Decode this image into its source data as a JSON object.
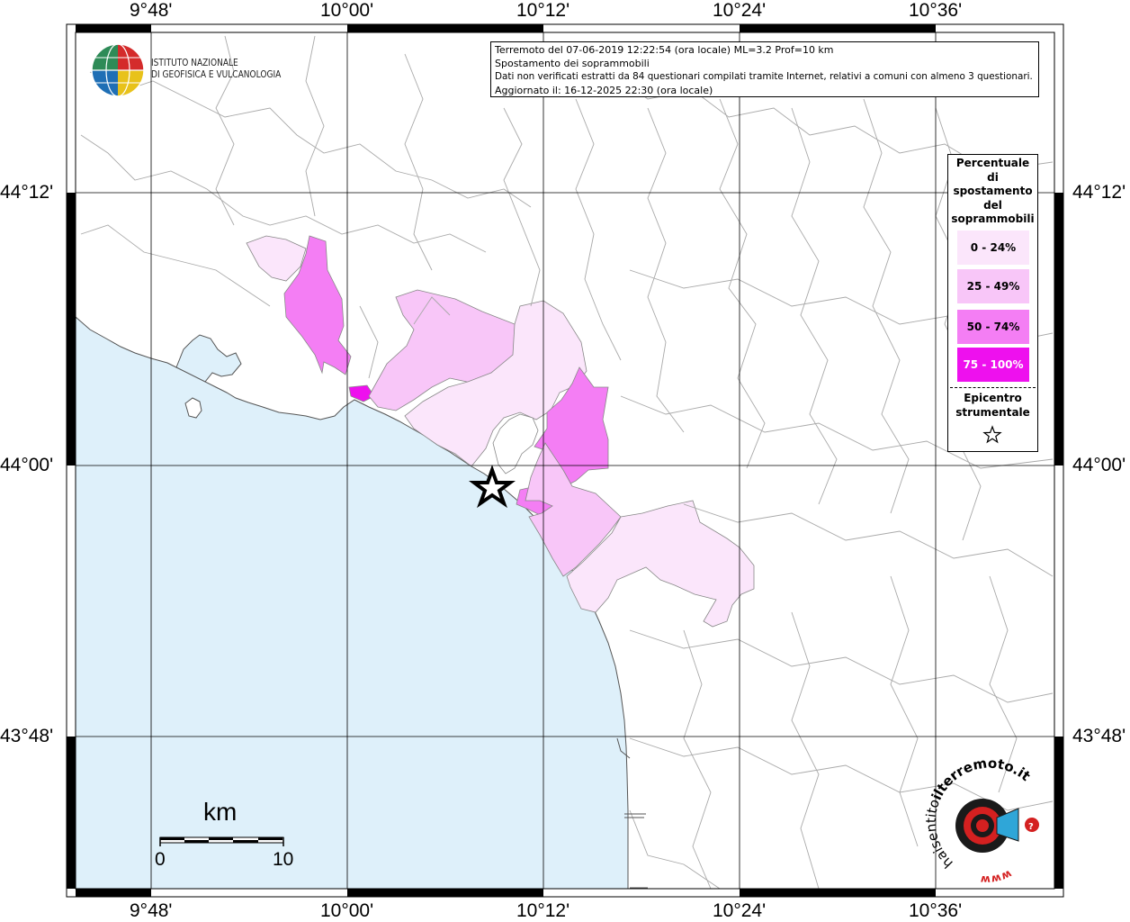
{
  "map": {
    "coordinates": {
      "longitude_labels": [
        "9°48'",
        "10°00'",
        "10°12'",
        "10°24'",
        "10°36'"
      ],
      "latitude_labels": [
        "44°12'",
        "44°00'",
        "43°48'"
      ]
    },
    "info_box": {
      "line1": "Terremoto del 07-06-2019 12:22:54 (ora locale) ML=3.2 Prof=10 km",
      "line2": "Spostamento dei soprammobili",
      "line3": "Dati non verificati estratti da 84 questionari compilati tramite Internet, relativi a comuni con almeno 3 questionari.",
      "line4": "Aggiornato il: 16-12-2025 22:30 (ora locale)"
    },
    "logo": {
      "institute_line1": "ISTITUTO NAZIONALE",
      "institute_line2": "DI GEOFISICA E VULCANOLOGIA"
    },
    "legend": {
      "title_lines": [
        "Percentuale",
        "di",
        "spostamento",
        "del",
        "soprammobili"
      ],
      "classes": [
        {
          "label": "0 - 24%",
          "color": "#fbe6fb"
        },
        {
          "label": "25 - 49%",
          "color": "#f8c6f8"
        },
        {
          "label": "50 - 74%",
          "color": "#f47ef4"
        },
        {
          "label": "75 - 100%",
          "color": "#ee10ee"
        }
      ],
      "epicenter_lines": [
        "Epicentro",
        "strumentale"
      ]
    },
    "scale_bar": {
      "unit": "km",
      "ticks": [
        "0",
        "10"
      ]
    },
    "colors": {
      "sea": "#def0fa",
      "land": "#ffffff",
      "border": "#a9a9a9",
      "grid": "#000000"
    },
    "badge": {
      "text_top": "haisentito",
      "text_mid": "ilterremoto.it",
      "text_bottom": "www"
    }
  }
}
